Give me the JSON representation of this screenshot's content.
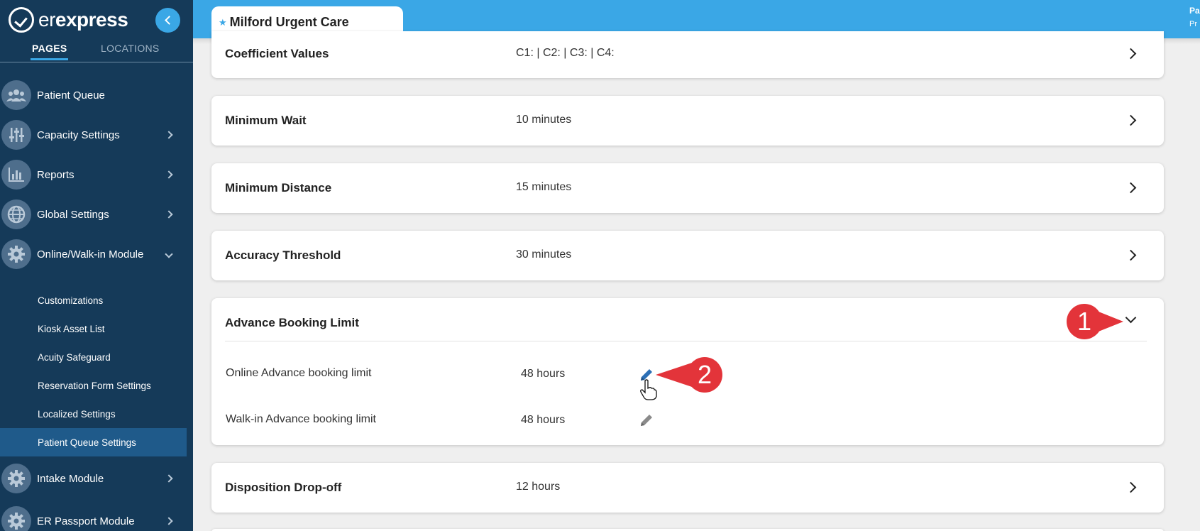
{
  "brand": {
    "er": "er",
    "express": "express"
  },
  "sidebar": {
    "tabs": {
      "pages": "PAGES",
      "locations": "LOCATIONS"
    },
    "items": [
      {
        "label": "Patient Queue",
        "icon": "users-icon"
      },
      {
        "label": "Capacity Settings",
        "icon": "sliders-icon"
      },
      {
        "label": "Reports",
        "icon": "bar-chart-icon"
      },
      {
        "label": "Global Settings",
        "icon": "globe-icon"
      },
      {
        "label": "Online/Walk-in Module",
        "icon": "gear-icon"
      },
      {
        "label": "Intake Module",
        "icon": "gear-icon"
      },
      {
        "label": "ER Passport Module",
        "icon": "gear-icon"
      }
    ],
    "subitems": [
      "Customizations",
      "Kiosk Asset List",
      "Acuity Safeguard",
      "Reservation Form Settings",
      "Localized Settings",
      "Patient Queue Settings"
    ]
  },
  "header": {
    "location_tab": "Milford Urgent Care",
    "user_line1": "Pa",
    "user_line2": "Pr"
  },
  "cards": [
    {
      "title": "Coefficient Values",
      "value": "C1: | C2: | C3: | C4:"
    },
    {
      "title": "Minimum Wait",
      "value": "10 minutes"
    },
    {
      "title": "Minimum Distance",
      "value": "15 minutes"
    },
    {
      "title": "Accuracy Threshold",
      "value": "30 minutes"
    },
    {
      "title": "Advance Booking Limit",
      "value": ""
    },
    {
      "title": "Disposition Drop-off",
      "value": "12 hours"
    }
  ],
  "advance_booking": {
    "rows": [
      {
        "label": "Online Advance booking limit",
        "value": "48 hours"
      },
      {
        "label": "Walk-in Advance booking limit",
        "value": "48 hours"
      }
    ]
  },
  "annotations": {
    "one": "1",
    "two": "2"
  },
  "colors": {
    "sidebar": "#153a59",
    "accent": "#3aa7e6",
    "active_sub": "#1f5a8a",
    "callout": "#e3343a"
  }
}
